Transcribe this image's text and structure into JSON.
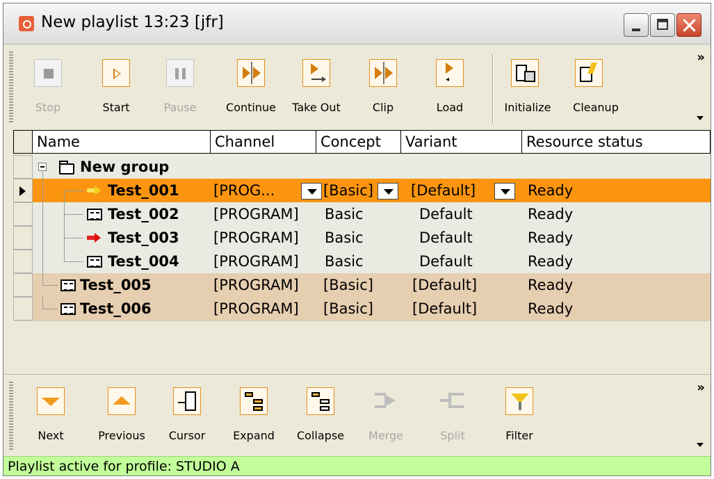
{
  "window": {
    "title": "New playlist 13:23 [jfr]"
  },
  "toolbar_top": {
    "buttons": [
      {
        "label": "Stop",
        "icon": "stop-icon",
        "enabled": false
      },
      {
        "label": "Start",
        "icon": "play-icon",
        "enabled": true
      },
      {
        "label": "Pause",
        "icon": "pause-icon",
        "enabled": false
      },
      {
        "label": "Continue",
        "icon": "continue-icon",
        "enabled": true
      },
      {
        "label": "Take Out",
        "icon": "take-out-icon",
        "enabled": true
      },
      {
        "label": "Clip",
        "icon": "clip-icon",
        "enabled": true
      },
      {
        "label": "Load",
        "icon": "load-icon",
        "enabled": true
      },
      {
        "label": "Initialize",
        "icon": "initialize-icon",
        "enabled": true
      },
      {
        "label": "Cleanup",
        "icon": "cleanup-icon",
        "enabled": true
      }
    ],
    "overflow": "»"
  },
  "grid": {
    "columns": [
      "Name",
      "Channel",
      "Concept",
      "Variant",
      "Resource status"
    ],
    "group": {
      "label": "New group"
    },
    "rows": [
      {
        "name": "Test_001",
        "channel": "[PROG...",
        "concept": "[Basic]",
        "variant": "[Default]",
        "status": "Ready",
        "style": "selected",
        "icon": "yellow-arrow-icon"
      },
      {
        "name": "Test_002",
        "channel": "[PROGRAM]",
        "concept": "Basic",
        "variant": "Default",
        "status": "Ready",
        "style": "light",
        "icon": "element-icon"
      },
      {
        "name": "Test_003",
        "channel": "[PROGRAM]",
        "concept": "Basic",
        "variant": "Default",
        "status": "Ready",
        "style": "light",
        "icon": "red-arrow-icon"
      },
      {
        "name": "Test_004",
        "channel": "[PROGRAM]",
        "concept": "Basic",
        "variant": "Default",
        "status": "Ready",
        "style": "light",
        "icon": "element-icon"
      },
      {
        "name": "Test_005",
        "channel": "[PROGRAM]",
        "concept": "[Basic]",
        "variant": "[Default]",
        "status": "Ready",
        "style": "tan",
        "icon": "element-icon"
      },
      {
        "name": "Test_006",
        "channel": "[PROGRAM]",
        "concept": "[Basic]",
        "variant": "[Default]",
        "status": "Ready",
        "style": "tan",
        "icon": "element-icon"
      }
    ]
  },
  "toolbar_bottom": {
    "buttons": [
      {
        "label": "Next",
        "icon": "next-icon",
        "enabled": true
      },
      {
        "label": "Previous",
        "icon": "previous-icon",
        "enabled": true
      },
      {
        "label": "Cursor",
        "icon": "cursor-icon",
        "enabled": true
      },
      {
        "label": "Expand",
        "icon": "expand-icon",
        "enabled": true
      },
      {
        "label": "Collapse",
        "icon": "collapse-icon",
        "enabled": true
      },
      {
        "label": "Merge",
        "icon": "merge-icon",
        "enabled": false
      },
      {
        "label": "Split",
        "icon": "split-icon",
        "enabled": false
      },
      {
        "label": "Filter",
        "icon": "filter-icon",
        "enabled": true
      }
    ],
    "overflow": "»"
  },
  "status": {
    "text": "Playlist active for profile: STUDIO A"
  },
  "colors": {
    "selected_row": "#fb950f",
    "tan_row": "#e6ceb0",
    "light_row": "#e9ebe2",
    "statusbar": "#c2ff9a",
    "accent": "#e48e1c"
  }
}
